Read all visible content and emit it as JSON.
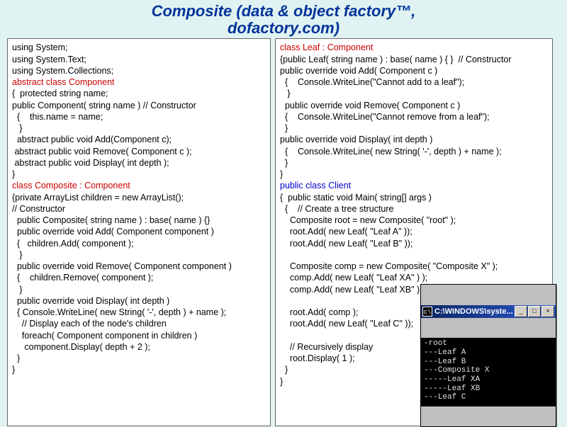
{
  "title_line1": "Composite (data & object factory™,",
  "title_line2": "dofactory.com)",
  "left": {
    "l1": "using System;",
    "l2": "using System.Text;",
    "l3": "using System.Collections;",
    "l4": "abstract class Component",
    "l5": "{  protected string name;",
    "l6": "public Component( string name ) // Constructor",
    "l7": "  {    this.name = name;",
    "l8": "   }",
    "l9": "  abstract public void Add(Component c);",
    "l10": " abstract public void Remove( Component c );",
    "l11": " abstract public void Display( int depth );",
    "l12": "}",
    "l13": "class Composite : Component",
    "l14": "{private ArrayList children = new ArrayList();",
    "l15": "// Constructor",
    "l16": "  public Composite( string name ) : base( name ) {}",
    "l17": "  public override void Add( Component component )",
    "l18": "  {   children.Add( component );",
    "l19": "   }",
    "l20": "  public override void Remove( Component component )",
    "l21": "  {    children.Remove( component );",
    "l22": "   }",
    "l23": "  public override void Display( int depth )",
    "l24": "  { Console.WriteLine( new String( '-', depth ) + name );",
    "l25": "    // Display each of the node's children",
    "l26": "    foreach( Component component in children )",
    "l27": "     component.Display( depth + 2 );",
    "l28": "  }",
    "l29": "}"
  },
  "right": {
    "r1": "class Leaf : Component",
    "r2": "{public Leaf( string name ) : base( name ) { }  // Constructor",
    "r3": "public override void Add( Component c )",
    "r4": "  {    Console.WriteLine(\"Cannot add to a leaf\");",
    "r5": "   }",
    "r6": "  public override void Remove( Component c )",
    "r7": "  {    Console.WriteLine(\"Cannot remove from a leaf\");",
    "r8": "  }",
    "r9": "public override void Display( int depth )",
    "r10": "  {    Console.WriteLine( new String( '-', depth ) + name );",
    "r11": "  }",
    "r12": "}",
    "r13": "public class Client",
    "r14": "{  public static void Main( string[] args )",
    "r15": "  {    // Create a tree structure",
    "r16": "    Composite root = new Composite( \"root\" );",
    "r17": "    root.Add( new Leaf( \"Leaf A\" ));",
    "r18": "    root.Add( new Leaf( \"Leaf B\" ));",
    "r19": "",
    "r20": "    Composite comp = new Composite( \"Composite X\" );",
    "r21": "    comp.Add( new Leaf( \"Leaf XA\" ) );",
    "r22": "    comp.Add( new Leaf( \"Leaf XB\" ) );",
    "r23": "",
    "r24": "    root.Add( comp );",
    "r25": "    root.Add( new Leaf( \"Leaf C\" ));",
    "r26": "",
    "r27": "    // Recursively display",
    "r28": "    root.Display( 1 );",
    "r29": "  }",
    "r30": "}"
  },
  "console": {
    "title": "C:\\WINDOWS\\syste...",
    "output": "-root\n---Leaf A\n---Leaf B\n---Composite X\n-----Leaf XA\n-----Leaf XB\n---Leaf C"
  }
}
